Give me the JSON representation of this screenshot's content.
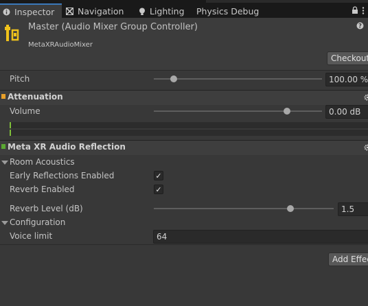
{
  "tabs": [
    {
      "label": "Inspector",
      "icon": "info-icon"
    },
    {
      "label": "Navigation",
      "icon": "navigation-icon"
    },
    {
      "label": "Lighting",
      "icon": "lightbulb-icon"
    },
    {
      "label": "Physics Debug",
      "icon": ""
    }
  ],
  "header": {
    "title": "Master (Audio Mixer Group Controller)",
    "subtitle": "MetaXRAudioMixer",
    "help_icon": "help-icon",
    "checkout_label": "Checkout"
  },
  "pitch": {
    "label": "Pitch",
    "value": "100.00 %",
    "slider_fraction": 0.12
  },
  "attenuation": {
    "title": "Attenuation",
    "accent": "#e8a02a",
    "volume_label": "Volume",
    "volume_value": "0.00 dB",
    "slider_fraction": 0.79
  },
  "reflection": {
    "title": "Meta XR Audio Reflection",
    "accent": "#5aa832",
    "room_acoustics": "Room Acoustics",
    "early_reflections_label": "Early Reflections Enabled",
    "early_reflections_checked": true,
    "reverb_enabled_label": "Reverb Enabled",
    "reverb_enabled_checked": true,
    "reverb_level_label": "Reverb Level (dB)",
    "reverb_level_value": "1.5",
    "reverb_slider_fraction": 0.76,
    "configuration": "Configuration",
    "voice_limit_label": "Voice limit",
    "voice_limit_value": "64"
  },
  "add_effect_label": "Add Effect",
  "check_glyph": "✓",
  "colors": {
    "tab_highlight": "#3a79bb",
    "background": "#383838"
  }
}
